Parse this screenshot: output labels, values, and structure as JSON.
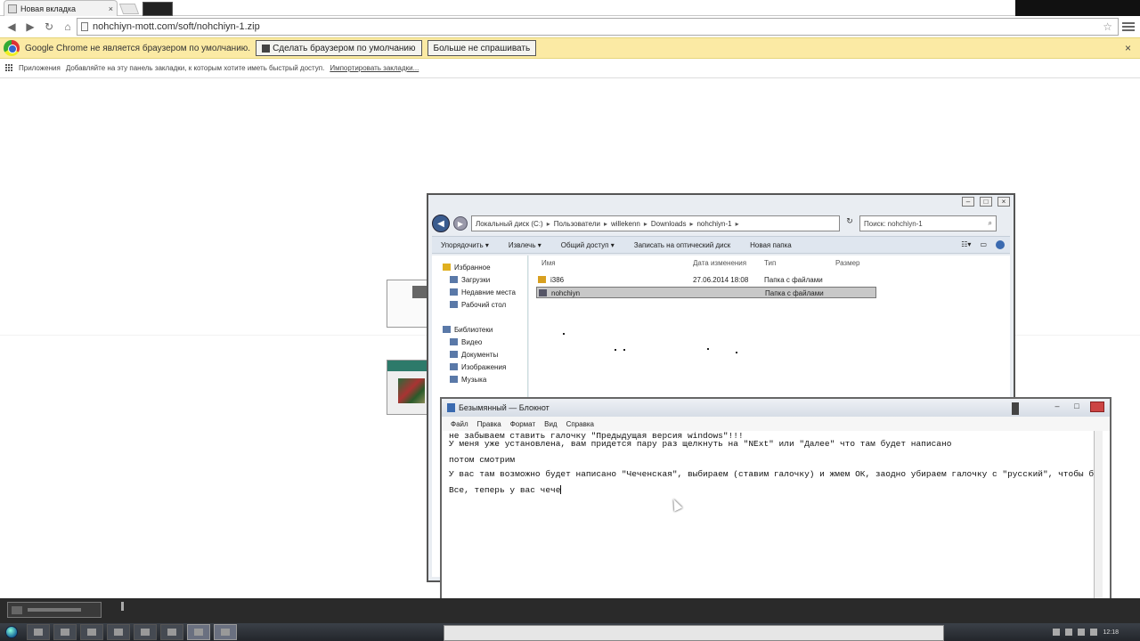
{
  "browser": {
    "tab_title": "Новая вкладка",
    "tab_close": "×",
    "url": "nohchiyn-mott.com/soft/nohchiyn-1.zip",
    "star": "☆"
  },
  "infobar": {
    "message": "Google Chrome не является браузером по умолчанию.",
    "make_default": "Сделать браузером по умолчанию",
    "dont_ask": "Больше не спрашивать",
    "close": "×"
  },
  "bookmarks": {
    "apps": "Приложения",
    "hint": "Добавляйте на эту панель закладки, к которым хотите иметь быстрый доступ.",
    "import": "Импортировать закладки..."
  },
  "explorer": {
    "address": [
      "Локальный диск (C:)",
      "Пользователи",
      "willekenn",
      "Downloads",
      "nohchiyn-1"
    ],
    "search_placeholder": "Поиск: nohchiyn-1",
    "commands": [
      "Упорядочить ▾",
      "Извлечь ▾",
      "Общий доступ ▾",
      "Записать на оптический диск",
      "Новая папка"
    ],
    "columns": [
      "Имя",
      "Дата изменения",
      "Тип",
      "Размер"
    ],
    "nav": {
      "favorites": "Избранное",
      "fav_items": [
        "Загрузки",
        "Недавние места",
        "Рабочий стол"
      ],
      "libraries": "Библиотеки",
      "lib_items": [
        "Видео",
        "Документы",
        "Изображения",
        "Музыка"
      ]
    },
    "files": [
      {
        "name": "i386",
        "date": "27.06.2014 18:08",
        "type": "Папка с файлами",
        "size": ""
      },
      {
        "name": "nohchiyn",
        "date": "",
        "type": "Папка с файлами",
        "size": ""
      }
    ]
  },
  "notepad": {
    "title": "Безымянный — Блокнот",
    "menu": [
      "Файл",
      "Правка",
      "Формат",
      "Вид",
      "Справка"
    ],
    "lines": [
      "не забываем ставить галочку \"Предыдущая версия windows\"!!!",
      "У меня уже установлена, вам придется пару раз щелкнуть на \"NExt\" или \"Далее\" что там будет написано",
      "",
      "потом смотрим",
      "",
      "У вас там возможно будет написано \"Чеченская\", выбираем (ставим галочку) и жмем ОК, заодно убираем галочку с \"русский\", чтобы была выбр",
      "",
      "Все, теперь у вас чече"
    ]
  },
  "taskbar": {
    "clock": "12:18"
  }
}
